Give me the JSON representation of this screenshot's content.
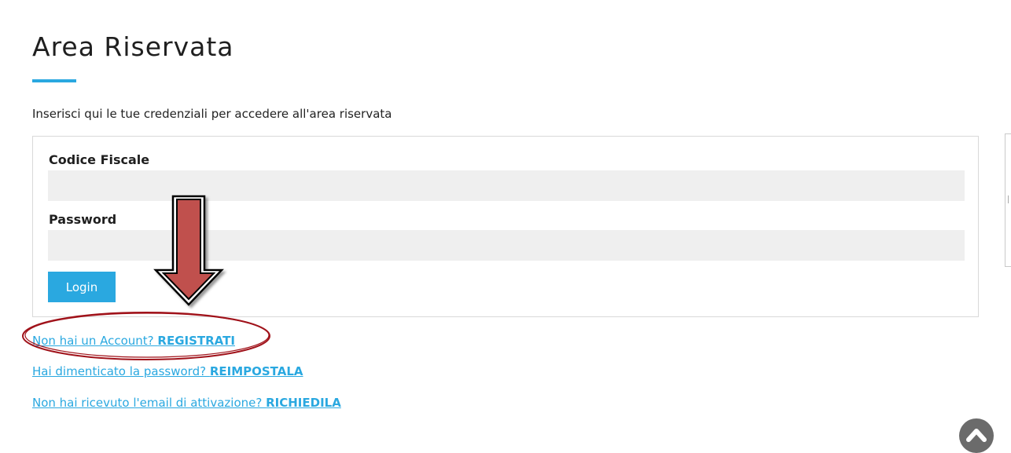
{
  "page": {
    "title": "Area Riservata",
    "intro": "Inserisci qui le tue credenziali per accedere all'area riservata"
  },
  "form": {
    "codice_fiscale_label": "Codice Fiscale",
    "codice_fiscale_value": "",
    "password_label": "Password",
    "password_value": "",
    "login_label": "Login"
  },
  "links": [
    {
      "text": "Non hai un Account? ",
      "strong": "REGISTRATI"
    },
    {
      "text": "Hai dimenticato la password? ",
      "strong": "REIMPOSTALA"
    },
    {
      "text": "Non hai ricevuto l'email di attivazione? ",
      "strong": "RICHIEDILA"
    }
  ],
  "colors": {
    "accent": "#2aa8e0",
    "annotation_arrow": "#c0504d",
    "annotation_ellipse": "#a0121a"
  },
  "icons": {
    "scroll_top": "chevron-up-icon"
  }
}
